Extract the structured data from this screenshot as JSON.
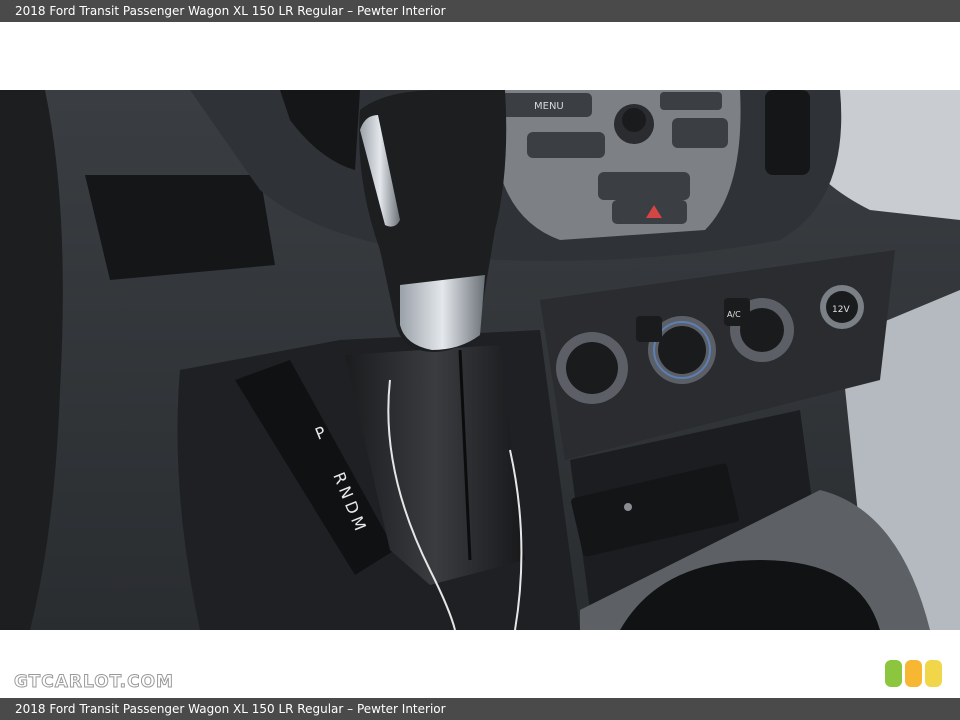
{
  "header": {
    "title": "2018 Ford Transit Passenger Wagon XL 150 LR Regular – Pewter Interior"
  },
  "footer": {
    "title": "2018 Ford Transit Passenger Wagon XL 150 LR Regular – Pewter Interior"
  },
  "watermark": {
    "text": "GTCARLOT.COM"
  },
  "photo": {
    "labels": {
      "menu": "MENU",
      "shift_p": "P",
      "shift_rndm": "RNDM",
      "ac": "A/C",
      "power_outlet": "12V"
    }
  },
  "rating": {
    "colors": [
      "#8cc63f",
      "#f7b733",
      "#f2d649"
    ]
  }
}
